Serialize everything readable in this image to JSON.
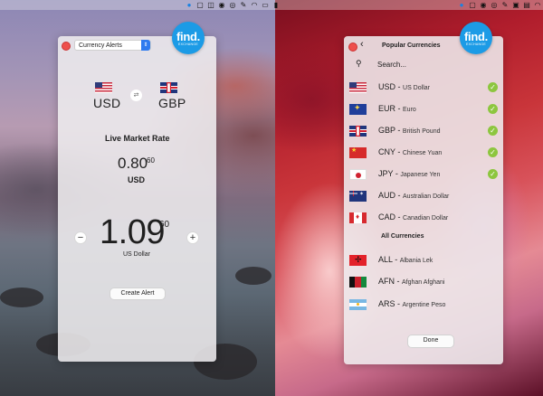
{
  "left_window": {
    "select_value": "Currency Alerts",
    "logo_text": "find.",
    "logo_sub": "EXCHANGE",
    "from_code": "USD",
    "to_code": "GBP",
    "swap_icon": "swap-arrows",
    "market_label": "Live Market Rate",
    "small_rate_main": "0.80",
    "small_rate_sup": "60",
    "small_rate_currency": "USD",
    "big_rate_main": "1.09",
    "big_rate_sup": "60",
    "big_rate_currency": "US Dollar",
    "minus_label": "−",
    "plus_label": "+",
    "create_alert_label": "Create Alert"
  },
  "right_window": {
    "title": "Popular Currencies",
    "logo_text": "find.",
    "logo_sub": "EXCHANGE",
    "search_placeholder": "Search...",
    "popular": [
      {
        "code": "USD",
        "name": "US Dollar",
        "flag": "us",
        "selected": true
      },
      {
        "code": "EUR",
        "name": "Euro",
        "flag": "eu",
        "selected": true
      },
      {
        "code": "GBP",
        "name": "British Pound",
        "flag": "gb",
        "selected": true
      },
      {
        "code": "CNY",
        "name": "Chinese Yuan",
        "flag": "cn",
        "selected": true
      },
      {
        "code": "JPY",
        "name": "Japanese Yen",
        "flag": "jp",
        "selected": true
      },
      {
        "code": "AUD",
        "name": "Australian Dollar",
        "flag": "au",
        "selected": false
      },
      {
        "code": "CAD",
        "name": "Canadian Dollar",
        "flag": "ca",
        "selected": false
      }
    ],
    "all_heading": "All Currencies",
    "all": [
      {
        "code": "ALL",
        "name": "Albania Lek",
        "flag": "al"
      },
      {
        "code": "AFN",
        "name": "Afghan Afghani",
        "flag": "af"
      },
      {
        "code": "ARS",
        "name": "Argentine Peso",
        "flag": "ar"
      }
    ],
    "done_label": "Done"
  },
  "colors": {
    "accent_blue": "#1c9be6",
    "check_green": "#8dc63f",
    "close_red": "#ee4f4c"
  }
}
